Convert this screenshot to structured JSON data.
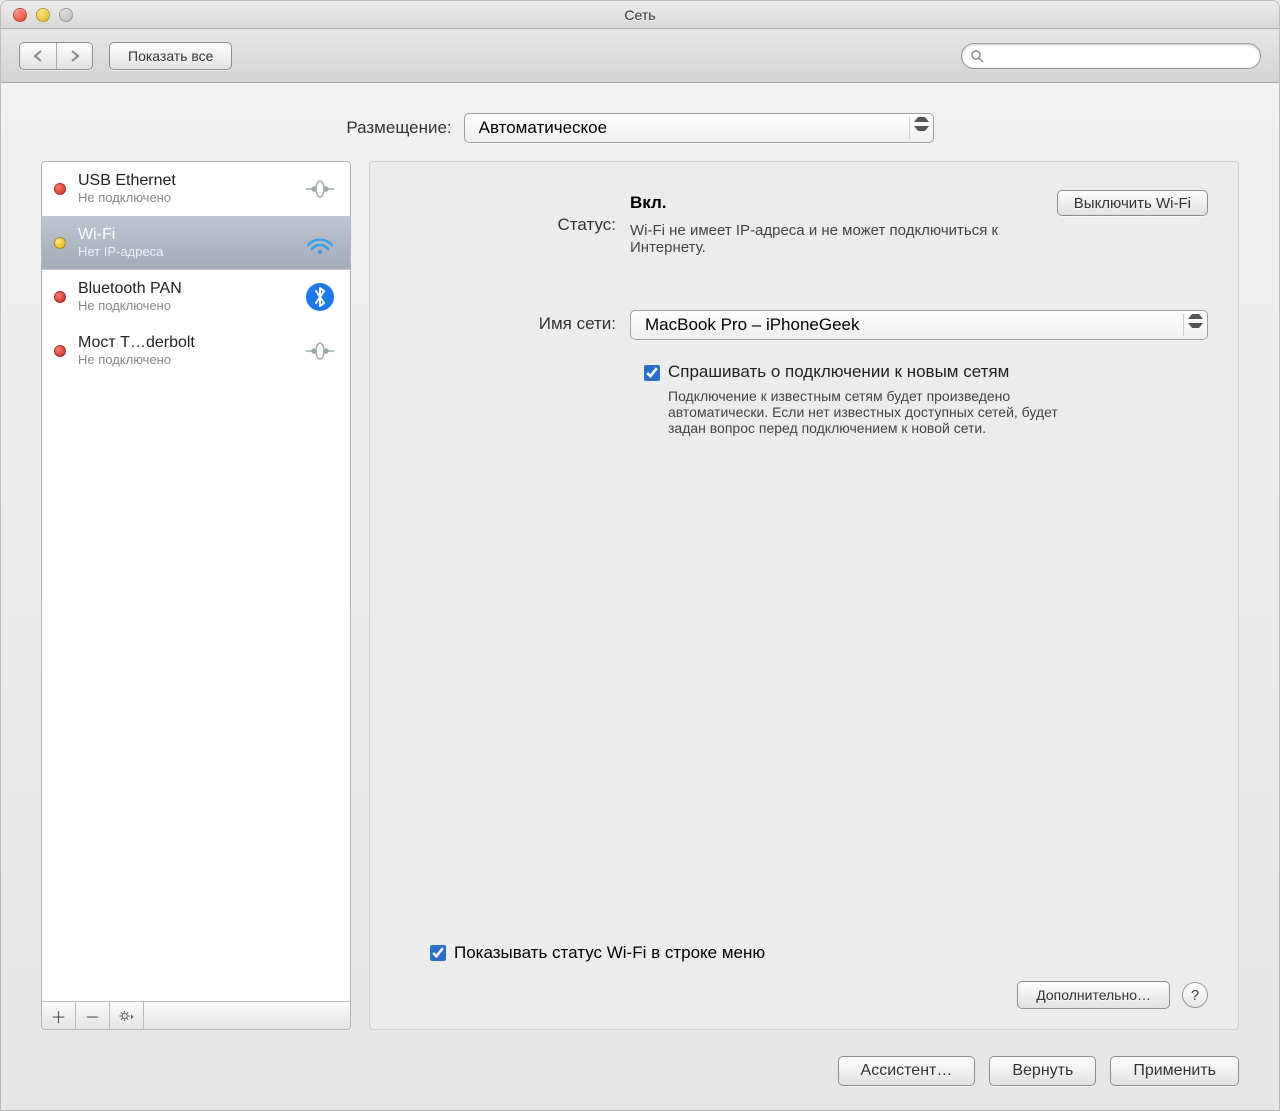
{
  "window_title": "Сеть",
  "toolbar": {
    "show_all_label": "Показать все"
  },
  "location": {
    "label": "Размещение:",
    "value": "Автоматическое"
  },
  "services": [
    {
      "name": "USB Ethernet",
      "status_text": "Не подключено",
      "dot": "red",
      "icon": "ethernet",
      "selected": false
    },
    {
      "name": "Wi-Fi",
      "status_text": "Нет IP-адреса",
      "dot": "yellow",
      "icon": "wifi",
      "selected": true
    },
    {
      "name": "Bluetooth PAN",
      "status_text": "Не подключено",
      "dot": "red",
      "icon": "bluetooth",
      "selected": false
    },
    {
      "name": "Мост T…derbolt",
      "status_text": "Не подключено",
      "dot": "red",
      "icon": "ethernet",
      "selected": false
    }
  ],
  "detail": {
    "status_label": "Статус:",
    "status_value": "Вкл.",
    "toggle_wifi_label": "Выключить Wi-Fi",
    "status_desc": "Wi-Fi не имеет IP-адреса и не может подключиться к Интернету.",
    "network_name_label": "Имя сети:",
    "network_name_value": "MacBook Pro – iPhoneGeek",
    "ask_join_label": "Спрашивать о подключении к новым сетям",
    "ask_join_checked": true,
    "ask_join_desc": "Подключение к известным сетям будет произведено автоматически. Если нет известных доступных сетей, будет задан вопрос перед подключением к новой сети.",
    "show_status_label": "Показывать статус Wi-Fi в строке меню",
    "show_status_checked": true,
    "advanced_label": "Дополнительно…",
    "help_label": "?"
  },
  "buttons": {
    "assistant": "Ассистент…",
    "revert": "Вернуть",
    "apply": "Применить"
  }
}
